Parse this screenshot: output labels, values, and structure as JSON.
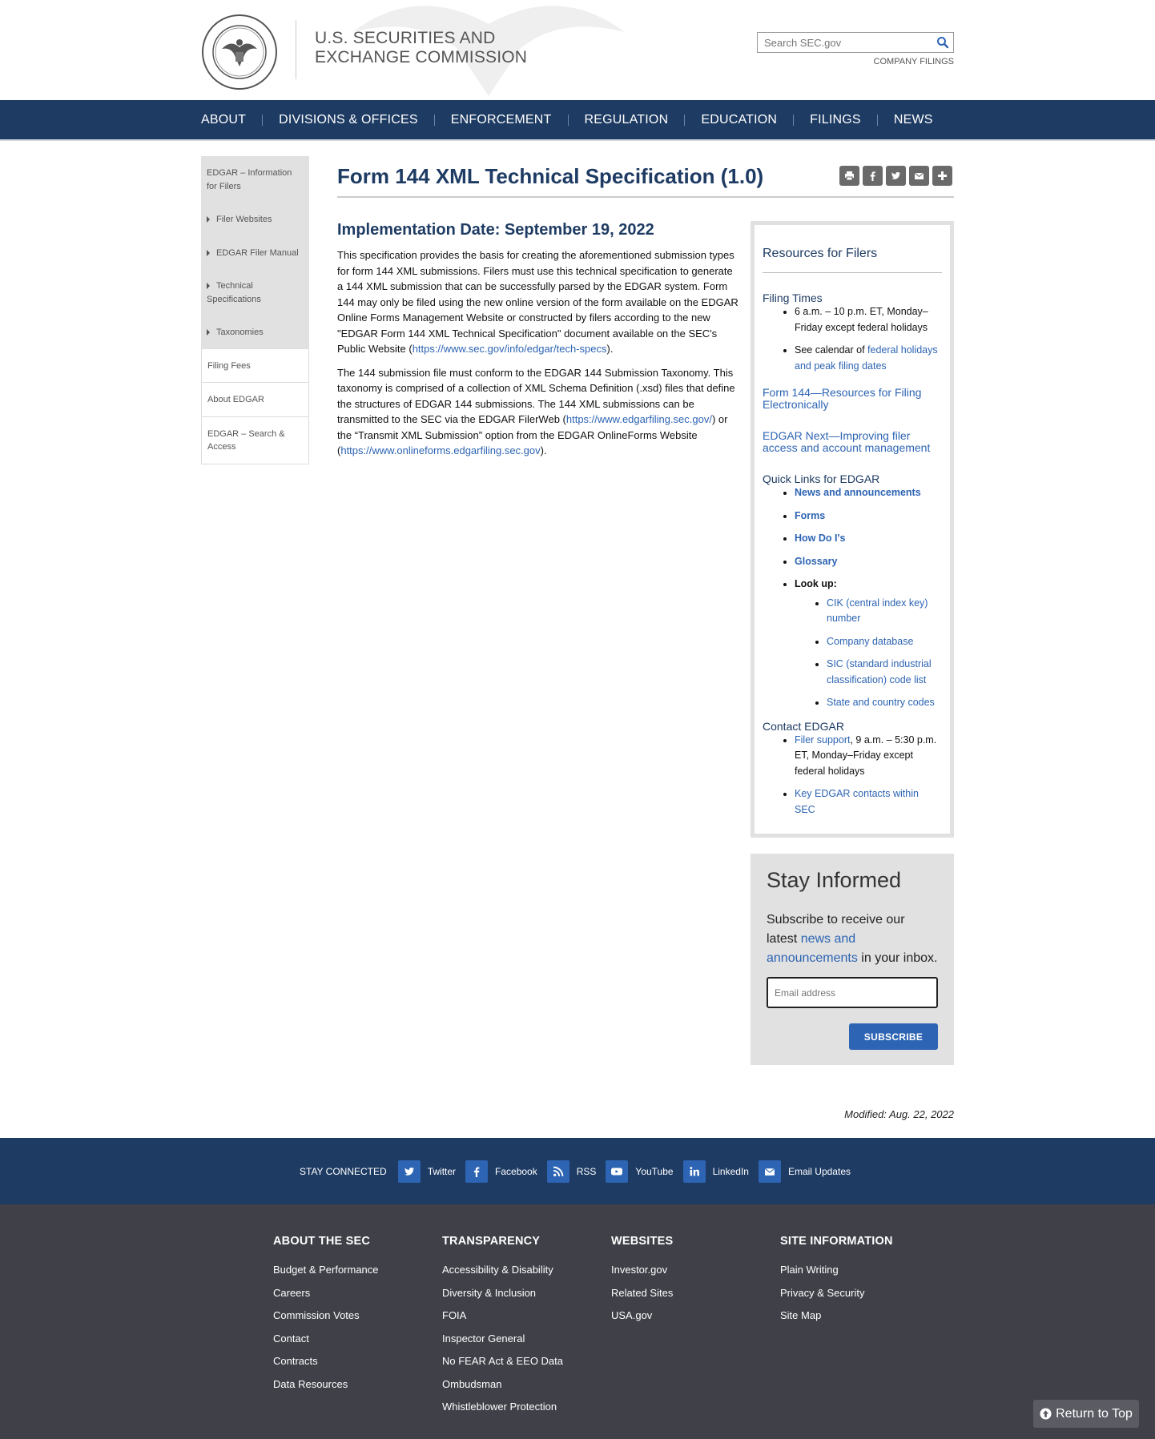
{
  "header": {
    "agency_line1": "U.S. SECURITIES AND",
    "agency_line2": "EXCHANGE COMMISSION",
    "search_placeholder": "Search SEC.gov",
    "company_filings": "COMPANY FILINGS"
  },
  "nav": {
    "items": [
      "ABOUT",
      "DIVISIONS & OFFICES",
      "ENFORCEMENT",
      "REGULATION",
      "EDUCATION",
      "FILINGS",
      "NEWS"
    ]
  },
  "sidebar": {
    "items": [
      "EDGAR – Information for Filers",
      "Filer Websites",
      "EDGAR Filer Manual",
      "Technical Specifications",
      "Taxonomies",
      "Filing Fees",
      "About EDGAR",
      "EDGAR – Search & Access"
    ]
  },
  "main": {
    "title": "Form 144 XML Technical Specification (1.0)",
    "implementation_date": "Implementation Date: September 19, 2022",
    "p1_a": "This specification provides the basis for creating the aforementioned submission types for form 144 XML submissions. Filers must use this technical specification to generate a 144 XML submission that can be successfully parsed by the EDGAR system. Form 144 may only be filed using the new online version of the form available on the EDGAR Online Forms Management Website or constructed by filers according to the new \"EDGAR Form 144 XML Technical Specification\" document available on the SEC's Public Website (",
    "p1_link": "https://www.sec.gov/info/edgar/tech-specs",
    "p1_b": ").",
    "p2_a": "The 144 submission file must conform to the EDGAR 144 Submission Taxonomy. This taxonomy is comprised of a collection of XML Schema Definition (.xsd) files that define the structures of EDGAR 144 submissions. The 144 XML submissions can be transmitted to the SEC via the EDGAR FilerWeb (",
    "p2_link1": "https://www.edgarfiling.sec.gov/",
    "p2_b": ") or the “Transmit XML Submission” option from the EDGAR OnlineForms Website (",
    "p2_link2": "https://www.onlineforms.edgarfiling.sec.gov",
    "p2_c": ").",
    "modified": "Modified: Aug. 22, 2022"
  },
  "resources": {
    "title": "Resources for Filers",
    "filing_times_heading": "Filing Times",
    "ft_item1": "6 a.m. – 10 p.m. ET, Monday–Friday except federal holidays",
    "ft_item2_text": "See calendar of ",
    "ft_item2_link": "federal holidays and peak filing dates",
    "form144_link": "Form 144—Resources for Filing Electronically",
    "edgar_next_link": "EDGAR Next—Improving filer access and account management",
    "quick_links_heading": "Quick Links for EDGAR",
    "quick_links": [
      "News and announcements",
      "Forms",
      "How Do I's",
      "Glossary"
    ],
    "lookup_label": "Look up:",
    "lookup_links": [
      "CIK (central index key) number",
      "Company database",
      "SIC (standard industrial classification) code list",
      "State and country codes"
    ],
    "contact_heading": "Contact EDGAR",
    "contact1_link": "Filer support",
    "contact1_text": ", 9 a.m. – 5:30 p.m. ET, Monday–Friday except federal holidays",
    "contact2_link": "Key EDGAR contacts within SEC"
  },
  "stay_informed": {
    "title": "Stay Informed",
    "text_a": "Subscribe to receive our latest ",
    "link": "news and announcements",
    "text_b": " in your inbox.",
    "email_placeholder": "Email address",
    "button": "SUBSCRIBE"
  },
  "connect": {
    "label": "STAY CONNECTED",
    "items": [
      "Twitter",
      "Facebook",
      "RSS",
      "YouTube",
      "LinkedIn",
      "Email Updates"
    ]
  },
  "footer": {
    "about": {
      "heading": "ABOUT THE SEC",
      "links": [
        "Budget & Performance",
        "Careers",
        "Commission Votes",
        "Contact",
        "Contracts",
        "Data Resources"
      ]
    },
    "transparency": {
      "heading": "TRANSPARENCY",
      "links": [
        "Accessibility & Disability",
        "Diversity & Inclusion",
        "FOIA",
        "Inspector General",
        "No FEAR Act & EEO Data",
        "Ombudsman",
        "Whistleblower Protection"
      ]
    },
    "websites": {
      "heading": "WEBSITES",
      "links": [
        "Investor.gov",
        "Related Sites",
        "USA.gov"
      ]
    },
    "site_info": {
      "heading": "SITE INFORMATION",
      "links": [
        "Plain Writing",
        "Privacy & Security",
        "Site Map"
      ]
    },
    "return_to_top": "Return to Top"
  },
  "colors": {
    "navy": "#1e3b63",
    "link_blue": "#2d64b3",
    "footer_bg": "#3f4048",
    "sidebar_gray": "#e1e1e1"
  }
}
